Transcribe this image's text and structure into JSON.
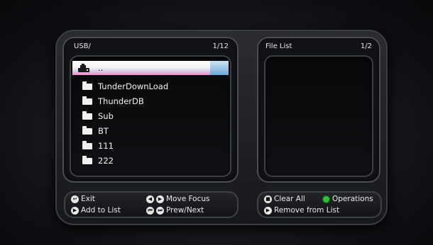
{
  "left_panel": {
    "path": "USB/",
    "page": "1/12",
    "items": [
      {
        "name": "..",
        "icon": "usb-device-icon",
        "selected": true
      },
      {
        "name": "TunderDownLoad",
        "icon": "folder-icon"
      },
      {
        "name": "ThunderDB",
        "icon": "folder-icon"
      },
      {
        "name": "Sub",
        "icon": "folder-icon"
      },
      {
        "name": "BT",
        "icon": "folder-icon"
      },
      {
        "name": "111",
        "icon": "folder-icon"
      },
      {
        "name": "222",
        "icon": "folder-icon"
      }
    ]
  },
  "right_panel": {
    "title": "File List",
    "page": "1/2"
  },
  "left_footer": {
    "exit": "Exit",
    "move_focus": "Move Focus",
    "add_to_list": "Add to List",
    "prev_next": "Prew/Next"
  },
  "right_footer": {
    "clear_all": "Clear All",
    "operations": "Operations",
    "remove_from_list": "Remove from List"
  },
  "colors": {
    "accent_green": "#2ec13b",
    "selection_pink": "#f08cc8",
    "selection_blue": "#6aa7d8"
  }
}
